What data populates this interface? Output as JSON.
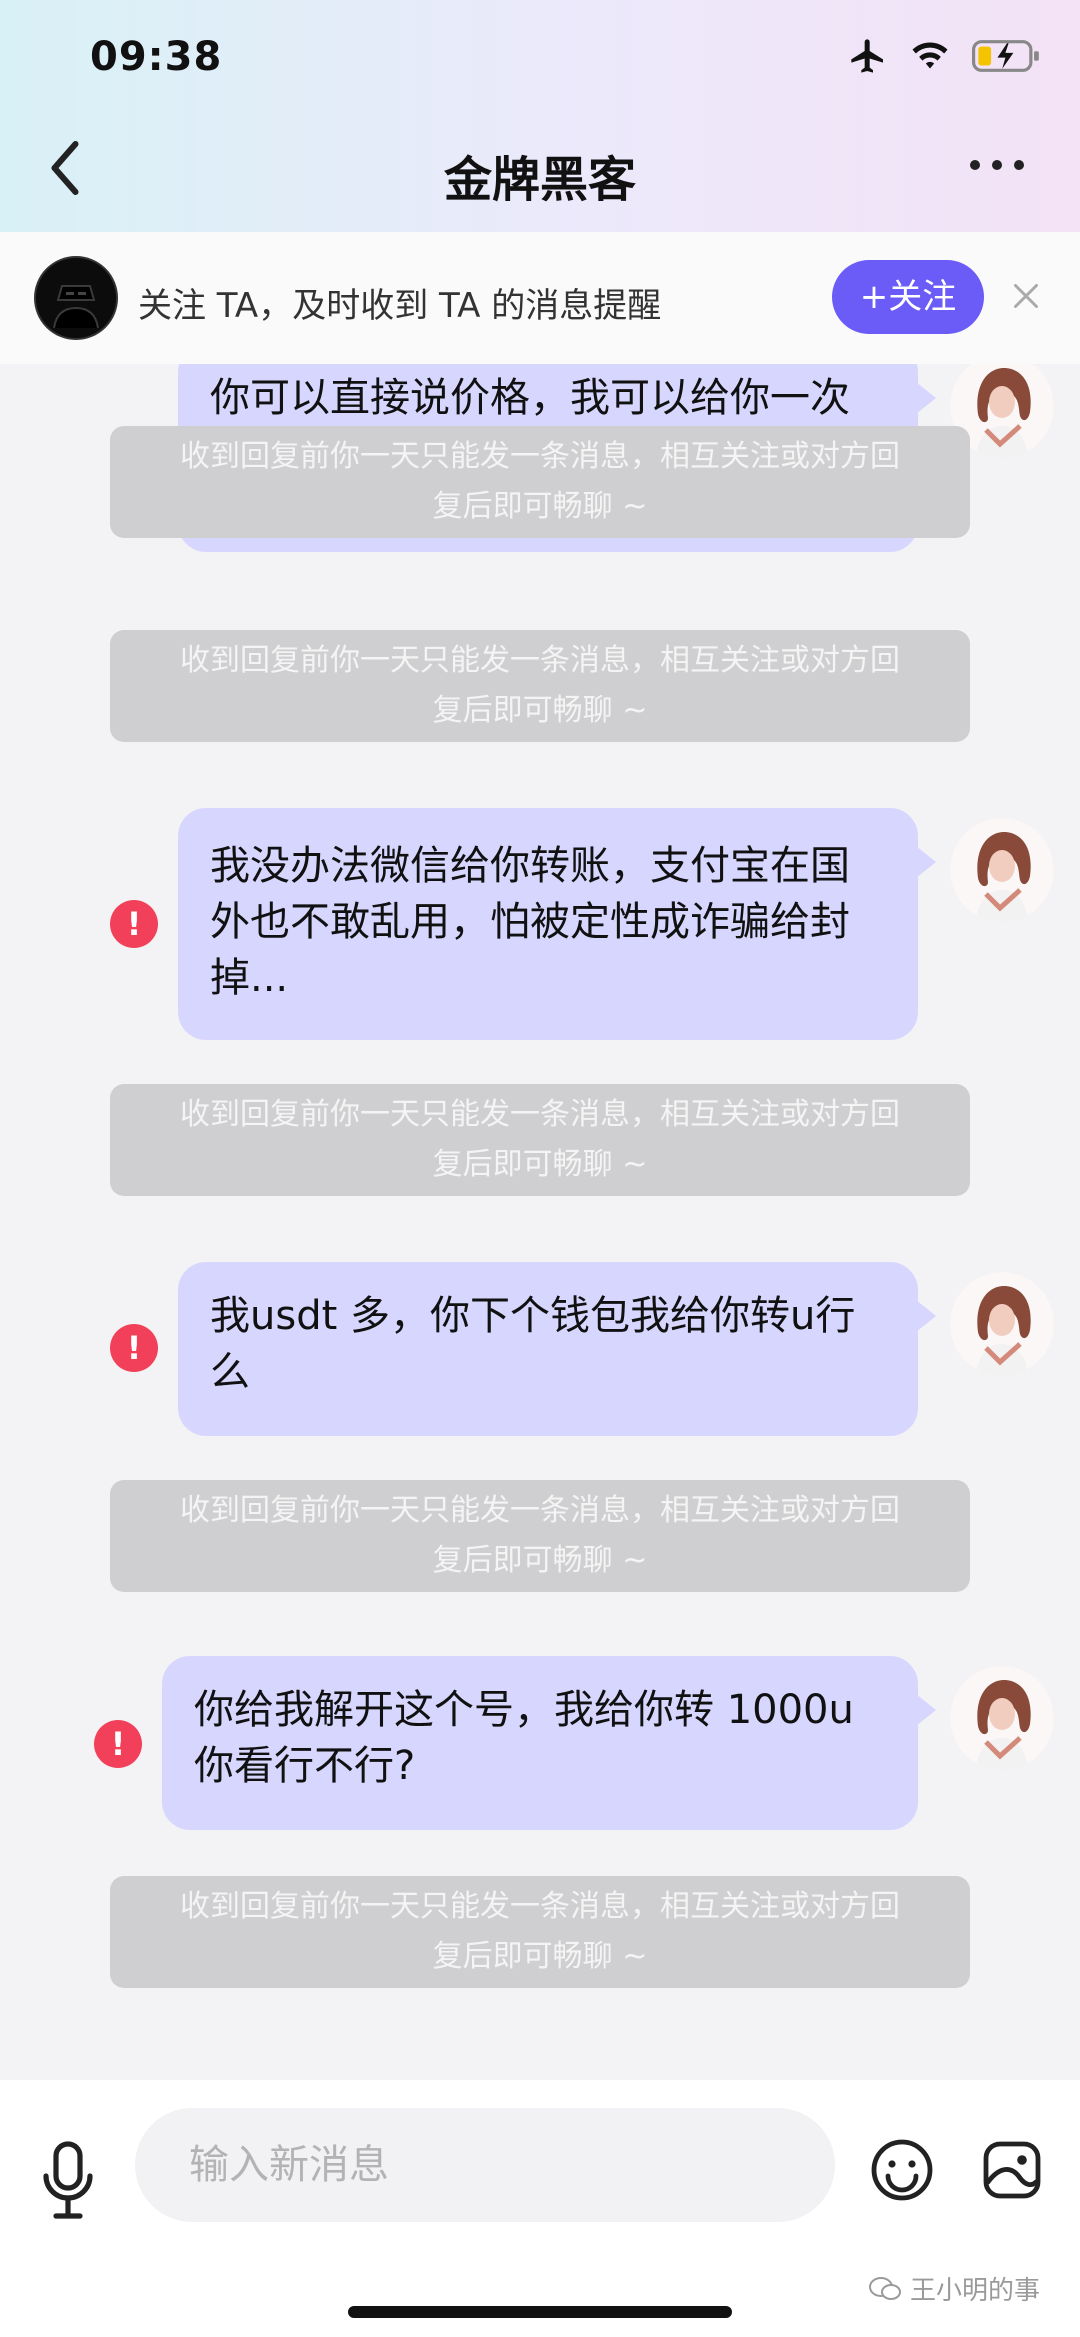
{
  "status": {
    "time": "09:38"
  },
  "nav": {
    "title": "金牌黑客"
  },
  "follow_bar": {
    "text": "关注 TA，及时收到 TA 的消息提醒",
    "button": "+关注"
  },
  "messages": [
    {
      "text": "你可以直接说价格，我可以给你一次付清，只要能解开我这边不在乎价格的",
      "error_mark": "!"
    },
    {
      "text": "我没办法微信给你转账，支付宝在国外也不敢乱用，怕被定性成诈骗给封掉...",
      "error_mark": "!"
    },
    {
      "text": "我usdt 多，你下个钱包我给你转u行么",
      "error_mark": "!"
    },
    {
      "text": "你给我解开这个号，我给你转 1000u你看行不行?",
      "error_mark": "!"
    }
  ],
  "notice": {
    "line1": "收到回复前你一天只能发一条消息，相互关注或对方回",
    "line2": "复后即可畅聊 ~"
  },
  "composer": {
    "placeholder": "输入新消息"
  },
  "watermark": "王小明的事",
  "colors": {
    "accent": "#6b5cf7",
    "bubble": "#d7d6fe",
    "error": "#f2405a",
    "notice_bg": "#cfcfd1"
  }
}
